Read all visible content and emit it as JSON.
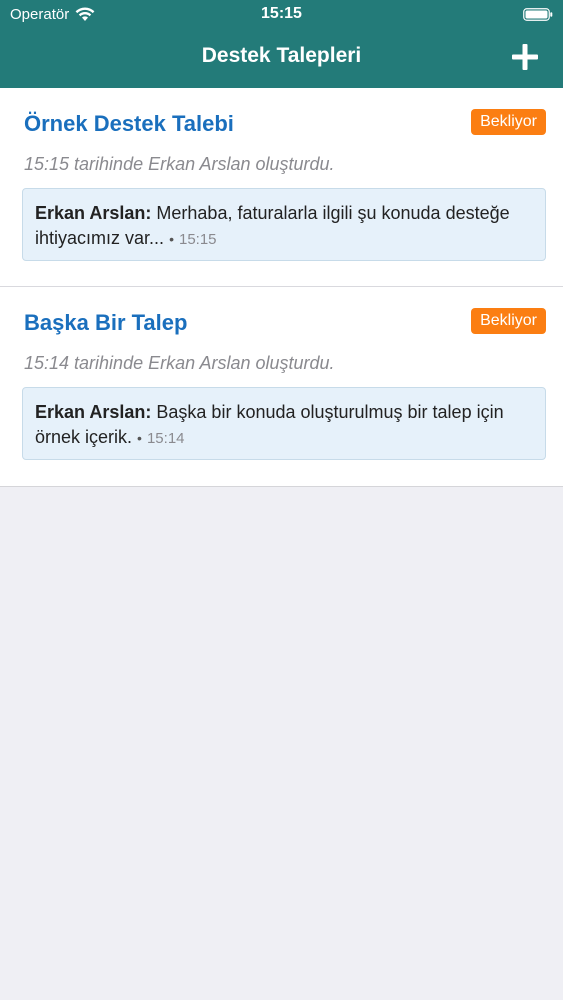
{
  "status_bar": {
    "carrier": "Operatör",
    "time": "15:15"
  },
  "nav": {
    "title": "Destek Talepleri",
    "add_icon": "plus-icon"
  },
  "tickets": [
    {
      "title": "Örnek Destek Talebi",
      "status": "Bekliyor",
      "meta": "15:15 tarihinde Erkan Arslan oluşturdu.",
      "last_message": {
        "author": "Erkan Arslan:",
        "text": "Merhaba, faturalarla ilgili şu konuda desteğe ihtiyacımız var...",
        "time": "15:15"
      }
    },
    {
      "title": "Başka Bir Talep",
      "status": "Bekliyor",
      "meta": "15:14 tarihinde Erkan Arslan oluşturdu.",
      "last_message": {
        "author": "Erkan Arslan:",
        "text": "Başka bir konuda oluşturulmuş bir talep için örnek içerik.",
        "time": "15:14"
      }
    }
  ],
  "colors": {
    "header_bg": "#237b79",
    "title_blue": "#1a6fbd",
    "badge_orange": "#fb7e12",
    "message_bg": "#e6f1fa",
    "page_bg": "#efeff4"
  }
}
